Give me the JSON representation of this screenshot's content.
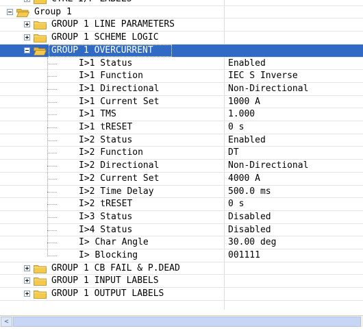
{
  "tree": {
    "rows": [
      {
        "label": "CTRL I/P LABELS",
        "value": "",
        "type": "folder-collapsed",
        "level": 1
      },
      {
        "label": "Group 1",
        "value": "",
        "type": "folder-open",
        "level": 0
      },
      {
        "label": "GROUP 1 LINE PARAMETERS",
        "value": "",
        "type": "folder-collapsed",
        "level": 1
      },
      {
        "label": "GROUP 1 SCHEME LOGIC",
        "value": "",
        "type": "folder-collapsed",
        "level": 1
      },
      {
        "label": "GROUP 1 OVERCURRENT",
        "value": "",
        "type": "folder-open",
        "level": 1,
        "selected": true
      },
      {
        "label": "I>1 Status",
        "value": "Enabled",
        "type": "leaf",
        "level": 2
      },
      {
        "label": "I>1 Function",
        "value": "IEC S Inverse",
        "type": "leaf",
        "level": 2
      },
      {
        "label": "I>1 Directional",
        "value": "Non-Directional",
        "type": "leaf",
        "level": 2
      },
      {
        "label": "I>1 Current Set",
        "value": "1000 A",
        "type": "leaf",
        "level": 2
      },
      {
        "label": "I>1 TMS",
        "value": "1.000",
        "type": "leaf",
        "level": 2
      },
      {
        "label": "I>1 tRESET",
        "value": "0 s",
        "type": "leaf",
        "level": 2
      },
      {
        "label": "I>2 Status",
        "value": "Enabled",
        "type": "leaf",
        "level": 2
      },
      {
        "label": "I>2 Function",
        "value": "DT",
        "type": "leaf",
        "level": 2
      },
      {
        "label": "I>2 Directional",
        "value": "Non-Directional",
        "type": "leaf",
        "level": 2
      },
      {
        "label": "I>2 Current Set",
        "value": "4000 A",
        "type": "leaf",
        "level": 2
      },
      {
        "label": "I>2 Time Delay",
        "value": "500.0 ms",
        "type": "leaf",
        "level": 2
      },
      {
        "label": "I>2 tRESET",
        "value": "0 s",
        "type": "leaf",
        "level": 2
      },
      {
        "label": "I>3 Status",
        "value": "Disabled",
        "type": "leaf",
        "level": 2
      },
      {
        "label": "I>4 Status",
        "value": "Disabled",
        "type": "leaf",
        "level": 2
      },
      {
        "label": "I> Char Angle",
        "value": "30.00 deg",
        "type": "leaf",
        "level": 2
      },
      {
        "label": "I> Blocking",
        "value": "001111",
        "type": "leaf",
        "level": 2
      },
      {
        "label": "GROUP 1 CB FAIL & P.DEAD",
        "value": "",
        "type": "folder-collapsed",
        "level": 1
      },
      {
        "label": "GROUP 1 INPUT LABELS",
        "value": "",
        "type": "folder-collapsed",
        "level": 1
      },
      {
        "label": "GROUP 1 OUTPUT LABELS",
        "value": "",
        "type": "folder-collapsed",
        "level": 1
      }
    ]
  },
  "scrollbar": {
    "left_arrow": "<"
  },
  "colors": {
    "selection": "#316ac5",
    "folder": "#f5c94c"
  }
}
